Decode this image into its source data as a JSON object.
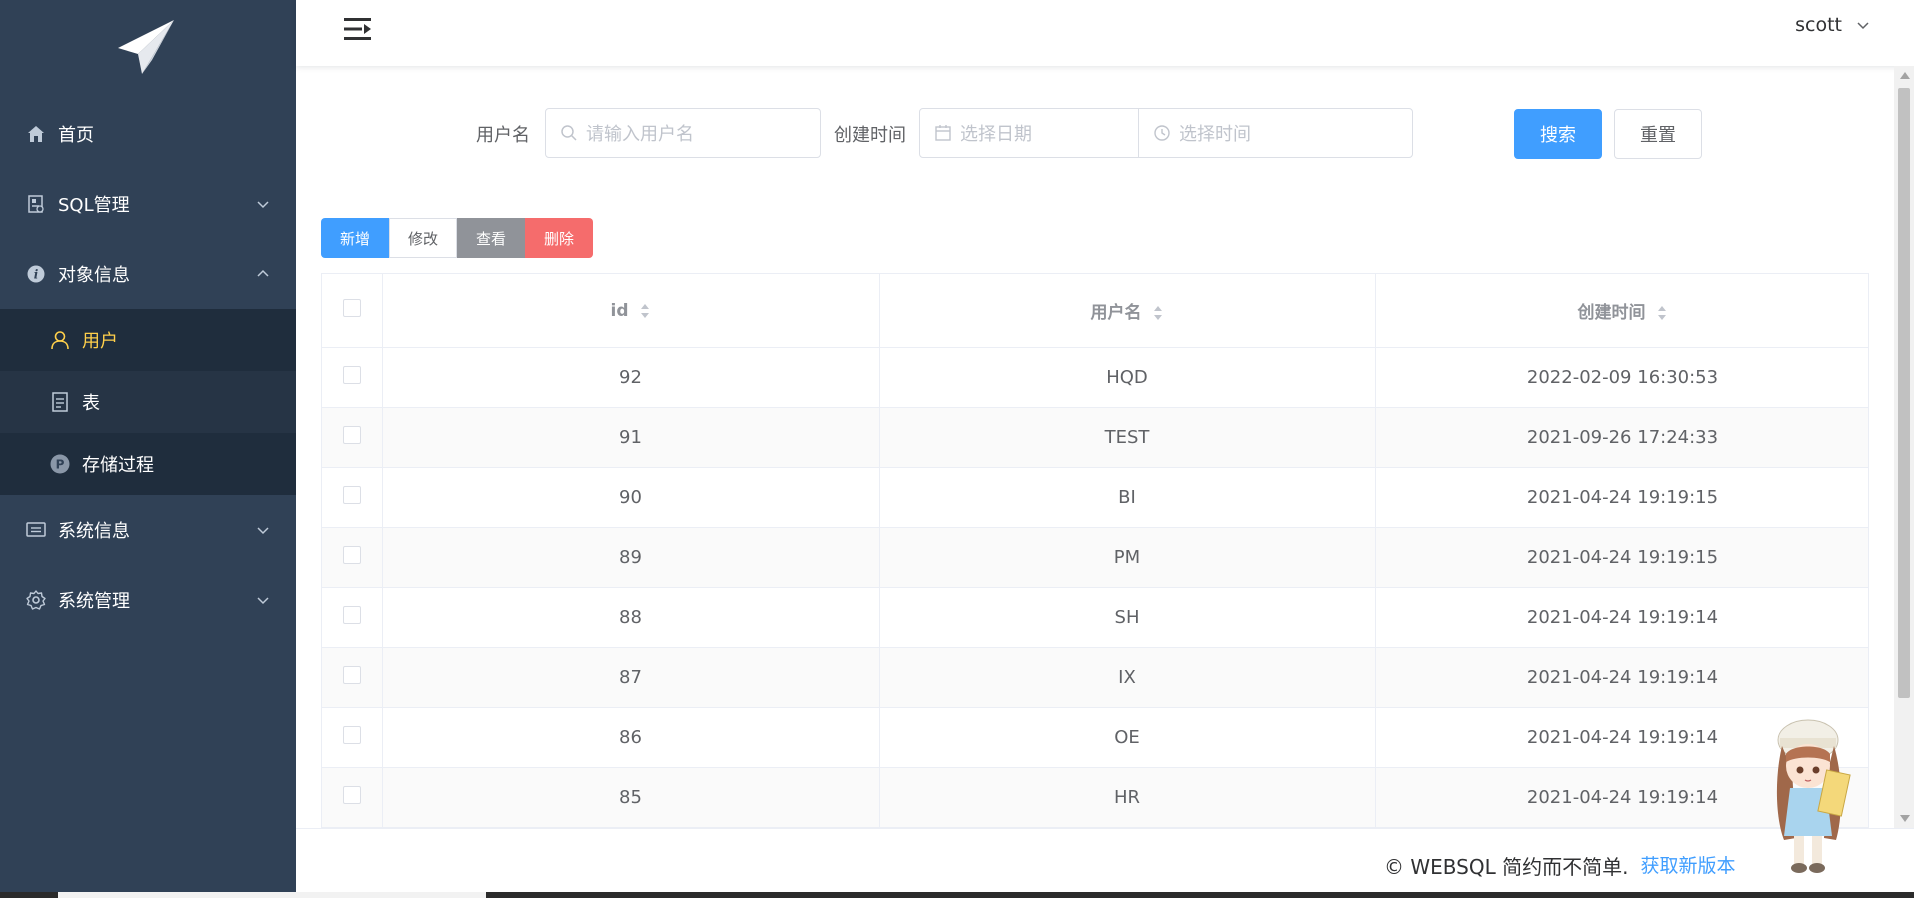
{
  "sidebar": {
    "logo_icon": "paper-plane-icon",
    "items": [
      {
        "label": "首页",
        "icon": "home-icon"
      },
      {
        "label": "SQL管理",
        "icon": "sql-icon"
      },
      {
        "label": "对象信息",
        "icon": "info-icon"
      },
      {
        "label": "系统信息",
        "icon": "message-icon"
      },
      {
        "label": "系统管理",
        "icon": "gear-icon"
      }
    ],
    "subitems": [
      {
        "label": "用户",
        "icon": "user-icon"
      },
      {
        "label": "表",
        "icon": "document-icon"
      },
      {
        "label": "存储过程",
        "icon": "procedure-icon",
        "badge": "P"
      }
    ]
  },
  "header": {
    "username": "scott"
  },
  "search": {
    "username_label": "用户名",
    "username_placeholder": "请输入用户名",
    "created_label": "创建时间",
    "date_placeholder": "选择日期",
    "time_placeholder": "选择时间",
    "search_button": "搜索",
    "reset_button": "重置"
  },
  "toolbar": {
    "add": "新增",
    "edit": "修改",
    "view": "查看",
    "delete": "删除"
  },
  "table": {
    "columns": [
      "id",
      "用户名",
      "创建时间"
    ],
    "rows": [
      {
        "id": "92",
        "name": "HQD",
        "created": "2022-02-09 16:30:53"
      },
      {
        "id": "91",
        "name": "TEST",
        "created": "2021-09-26 17:24:33"
      },
      {
        "id": "90",
        "name": "BI",
        "created": "2021-04-24 19:19:15"
      },
      {
        "id": "89",
        "name": "PM",
        "created": "2021-04-24 19:19:15"
      },
      {
        "id": "88",
        "name": "SH",
        "created": "2021-04-24 19:19:14"
      },
      {
        "id": "87",
        "name": "IX",
        "created": "2021-04-24 19:19:14"
      },
      {
        "id": "86",
        "name": "OE",
        "created": "2021-04-24 19:19:14"
      },
      {
        "id": "85",
        "name": "HR",
        "created": "2021-04-24 19:19:14"
      }
    ]
  },
  "footer": {
    "copyright": "© WEBSQL 简约而不简单.",
    "link": "获取新版本"
  },
  "colors": {
    "sidebar_bg": "#304156",
    "submenu_bg": "#1f2d3d",
    "active_text": "#ffd04b",
    "primary": "#409eff",
    "danger": "#f56c6c",
    "info": "#909399"
  }
}
